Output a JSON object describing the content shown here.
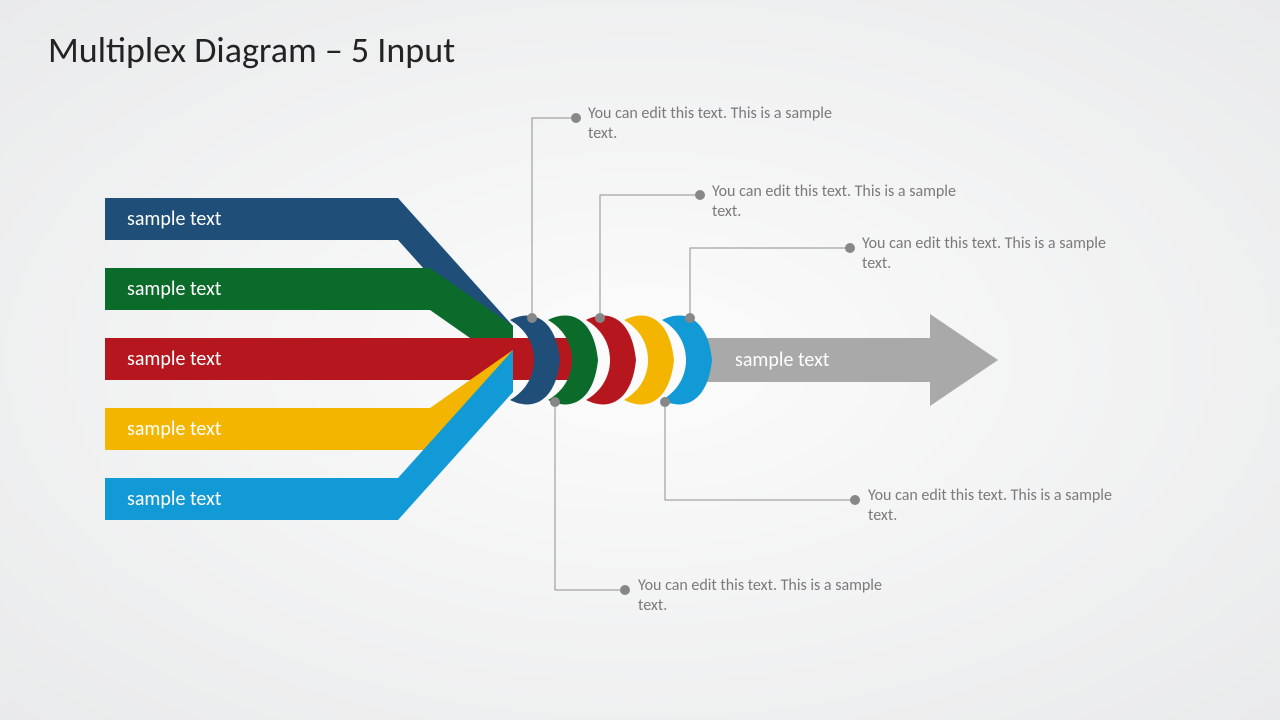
{
  "title": "Multiplex Diagram – 5 Input",
  "colors": {
    "navy": "#1f4e79",
    "green": "#0a6b2b",
    "red": "#b6171e",
    "yellow": "#f3b500",
    "blue": "#129ad6",
    "arrow": "#a9a9a9",
    "dot": "#878787",
    "line": "#8f8f8f",
    "text": "#7a7a7a"
  },
  "inputs": [
    {
      "label": "sample text",
      "color": "navy"
    },
    {
      "label": "sample text",
      "color": "green"
    },
    {
      "label": "sample text",
      "color": "red"
    },
    {
      "label": "sample text",
      "color": "yellow"
    },
    {
      "label": "sample text",
      "color": "blue"
    }
  ],
  "output_label": "sample text",
  "callouts": {
    "c1": "You can edit this text. This is a sample text.",
    "c2": "You can edit this text. This is a sample text.",
    "c3": "You can edit this text. This is a sample text.",
    "c4": "You can edit this text. This is a sample text.",
    "c5": "You can edit this text. This is a sample text."
  }
}
